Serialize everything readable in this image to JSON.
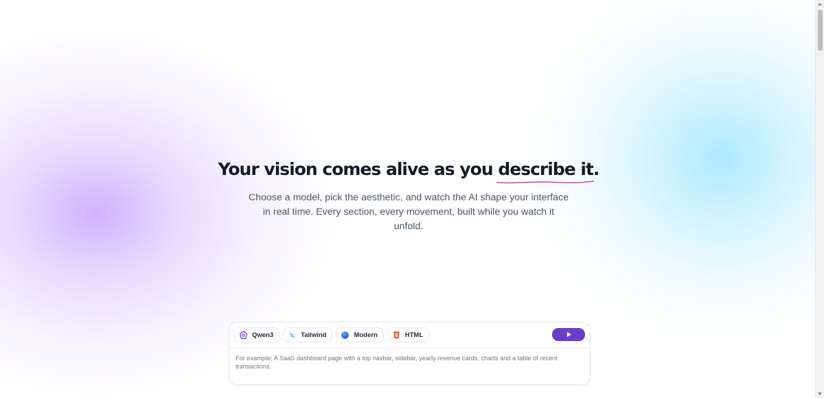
{
  "hero": {
    "headline_prefix": "Your vision comes alive as you ",
    "headline_highlight": "describe it",
    "headline_suffix": ".",
    "subtitle": "Choose a model, pick the aesthetic, and watch the AI shape your interface in real time. Every section, every movement, built while you watch it unfold."
  },
  "composer": {
    "chips": [
      {
        "label": "Qwen3",
        "icon": "qwen-logo-icon"
      },
      {
        "label": "Tailwind",
        "icon": "tailwind-logo-icon"
      },
      {
        "label": "Modern",
        "icon": "globe-circle-icon"
      },
      {
        "label": "HTML",
        "icon": "html5-logo-icon"
      }
    ],
    "run_icon": "play-icon",
    "prompt_placeholder": "For example: A SaaS dashboard page with a top navbar, sidebar, yearly revenue cards, charts and a table of recent transactions."
  },
  "colors": {
    "accent": "#6a3fc4",
    "underline": "#d946b0",
    "glow_left": "#c8a5ff",
    "glow_right": "#a0e6fc"
  }
}
